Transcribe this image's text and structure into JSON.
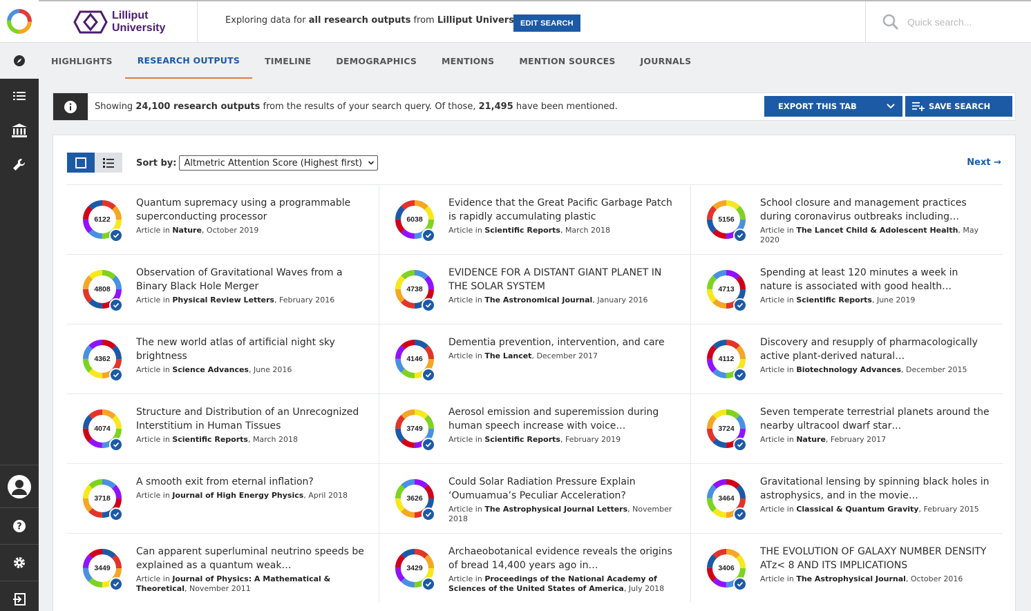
{
  "header": {
    "brand_line1": "Lilliput",
    "brand_line2": "University",
    "explore_prefix": "Exploring data for ",
    "explore_bold": "all research outputs",
    "explore_mid": " from ",
    "explore_org": "Lilliput University",
    "edit_search": "EDIT SEARCH",
    "quick_search_placeholder": "Quick search..."
  },
  "tabs": [
    {
      "label": "HIGHLIGHTS",
      "active": false
    },
    {
      "label": "RESEARCH OUTPUTS",
      "active": true
    },
    {
      "label": "TIMELINE",
      "active": false
    },
    {
      "label": "DEMOGRAPHICS",
      "active": false
    },
    {
      "label": "MENTIONS",
      "active": false
    },
    {
      "label": "MENTION SOURCES",
      "active": false
    },
    {
      "label": "JOURNALS",
      "active": false
    }
  ],
  "infobar": {
    "showing": "Showing ",
    "count": "24,100 research outputs",
    "mid": " from the results of your search query. Of those, ",
    "mentioned": "21,495",
    "tail": " have been mentioned.",
    "export": "EXPORT THIS TAB",
    "save": "SAVE SEARCH"
  },
  "controls": {
    "sort_label": "Sort by:",
    "sort_value": "Altmetric Attention Score (Highest first)",
    "next": "Next →"
  },
  "colors": {
    "accent": "#1c5aa6",
    "tab_underline": "#e07a3f",
    "brand": "#4a1c6e"
  },
  "outputs": [
    {
      "score": "6122",
      "title": "Quantum supremacy using a programmable superconducting processor",
      "type": "Article in ",
      "journal": "Nature",
      "date": ", October 2019"
    },
    {
      "score": "6038",
      "title": "Evidence that the Great Pacific Garbage Patch is rapidly accumulating plastic",
      "type": "Article in ",
      "journal": "Scientific Reports",
      "date": ", March 2018"
    },
    {
      "score": "5156",
      "title": "School closure and management practices during coronavirus outbreaks including…",
      "type": "Article in ",
      "journal": "The Lancet Child & Adolescent Health",
      "date": ", May 2020"
    },
    {
      "score": "4808",
      "title": "Observation of Gravitational Waves from a Binary Black Hole Merger",
      "type": "Article in ",
      "journal": "Physical Review Letters",
      "date": ", February 2016"
    },
    {
      "score": "4738",
      "title": "EVIDENCE FOR A DISTANT GIANT PLANET IN THE SOLAR SYSTEM",
      "type": "Article in ",
      "journal": "The Astronomical Journal",
      "date": ", January 2016"
    },
    {
      "score": "4713",
      "title": "Spending at least 120 minutes a week in nature is associated with good health…",
      "type": "Article in ",
      "journal": "Scientific Reports",
      "date": ", June 2019"
    },
    {
      "score": "4362",
      "title": "The new world atlas of artificial night sky brightness",
      "type": "Article in ",
      "journal": "Science Advances",
      "date": ", June 2016"
    },
    {
      "score": "4146",
      "title": "Dementia prevention, intervention, and care",
      "type": "Article in ",
      "journal": "The Lancet",
      "date": ", December 2017"
    },
    {
      "score": "4112",
      "title": "Discovery and resupply of pharmacologically active plant-derived natural…",
      "type": "Article in ",
      "journal": "Biotechnology Advances",
      "date": ", December 2015"
    },
    {
      "score": "4074",
      "title": "Structure and Distribution of an Unrecognized Interstitium in Human Tissues",
      "type": "Article in ",
      "journal": "Scientific Reports",
      "date": ", March 2018"
    },
    {
      "score": "3749",
      "title": "Aerosol emission and superemission during human speech increase with voice…",
      "type": "Article in ",
      "journal": "Scientific Reports",
      "date": ", February 2019"
    },
    {
      "score": "3724",
      "title": "Seven temperate terrestrial planets around the nearby ultracool dwarf star…",
      "type": "Article in ",
      "journal": "Nature",
      "date": ", February 2017"
    },
    {
      "score": "3718",
      "title": "A smooth exit from eternal inflation?",
      "type": "Article in ",
      "journal": "Journal of High Energy Physics",
      "date": ", April 2018"
    },
    {
      "score": "3626",
      "title": "Could Solar Radiation Pressure Explain ‘Oumuamua’s Peculiar Acceleration?",
      "type": "Article in ",
      "journal": "The Astrophysical Journal Letters",
      "date": ", November 2018"
    },
    {
      "score": "3464",
      "title": "Gravitational lensing by spinning black holes in astrophysics, and in the movie…",
      "type": "Article in ",
      "journal": "Classical & Quantum Gravity",
      "date": ", February 2015"
    },
    {
      "score": "3449",
      "title": "Can apparent superluminal neutrino speeds be explained as a quantum weak…",
      "type": "Article in ",
      "journal": "Journal of Physics: A Mathematical & Theoretical",
      "date": ", November 2011"
    },
    {
      "score": "3429",
      "title": "Archaeobotanical evidence reveals the origins of bread 14,400 years ago in…",
      "type": "Article in ",
      "journal": "Proceedings of the National Academy of Sciences of the United States of America",
      "date": ", July 2018"
    },
    {
      "score": "3406",
      "title": "THE EVOLUTION OF GALAXY NUMBER DENSITY ATz< 8 AND ITS IMPLICATIONS",
      "type": "Article in ",
      "journal": "The Astrophysical Journal",
      "date": ", October 2016"
    }
  ]
}
